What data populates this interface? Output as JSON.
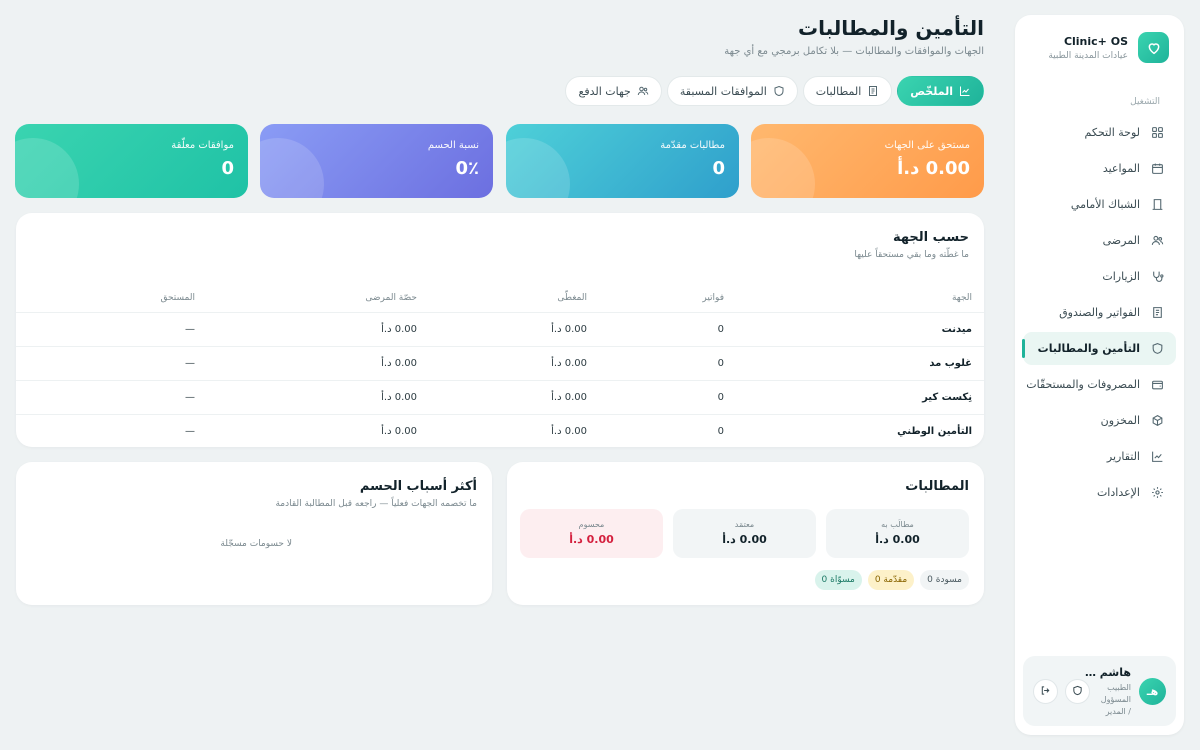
{
  "brand": {
    "name": "Clinic+ OS",
    "subtitle": "عيادات المدينة الطبية"
  },
  "nav": {
    "section": "التشغيل",
    "items": [
      {
        "label": "لوحة التحكم",
        "icon": "grid-icon"
      },
      {
        "label": "المواعيد",
        "icon": "calendar-icon"
      },
      {
        "label": "الشباك الأمامي",
        "icon": "door-icon"
      },
      {
        "label": "المرضى",
        "icon": "users-icon"
      },
      {
        "label": "الزيارات",
        "icon": "stethoscope-icon"
      },
      {
        "label": "الفواتير والصندوق",
        "icon": "receipt-icon"
      },
      {
        "label": "التأمين والمطالبات",
        "icon": "shield-icon",
        "active": true
      },
      {
        "label": "المصروفات والمستحقّات",
        "icon": "wallet-icon"
      },
      {
        "label": "المخزون",
        "icon": "box-icon"
      },
      {
        "label": "التقارير",
        "icon": "chart-icon"
      },
      {
        "label": "الإعدادات",
        "icon": "gear-icon"
      }
    ]
  },
  "user": {
    "initials": "هـ",
    "name": "هاشم …",
    "role": "الطبيب المسؤول / المدير"
  },
  "header": {
    "title": "التأمين والمطالبات",
    "subtitle": "الجهات والموافقات والمطالبات — بلا تكامل برمجي مع أي جهة"
  },
  "tabs": [
    {
      "label": "الملخّص",
      "icon": "chart-icon",
      "active": true
    },
    {
      "label": "المطالبات",
      "icon": "receipt-icon"
    },
    {
      "label": "الموافقات المسبقة",
      "icon": "shield-icon"
    },
    {
      "label": "جهات الدفع",
      "icon": "users-icon"
    }
  ],
  "stats": [
    {
      "label": "مستحق على الجهات",
      "value": "0.00 د.أ"
    },
    {
      "label": "مطالبات مقدّمة",
      "value": "0"
    },
    {
      "label": "نسبة الحسم",
      "value": "0٪"
    },
    {
      "label": "موافقات معلّقة",
      "value": "0"
    }
  ],
  "by_payer": {
    "title": "حسب الجهة",
    "subtitle": "ما غطّته وما بقي مستحقاً عليها",
    "columns": [
      "الجهة",
      "فواتير",
      "المغطّى",
      "حصّة المرضى",
      "المستحق"
    ],
    "rows": [
      [
        "ميدنت",
        "0",
        "0.00 د.أ",
        "0.00 د.أ",
        "—"
      ],
      [
        "غلوب مد",
        "0",
        "0.00 د.أ",
        "0.00 د.أ",
        "—"
      ],
      [
        "نِكست كير",
        "0",
        "0.00 د.أ",
        "0.00 د.أ",
        "—"
      ],
      [
        "التأمين الوطني",
        "0",
        "0.00 د.أ",
        "0.00 د.أ",
        "—"
      ]
    ]
  },
  "claims": {
    "title": "المطالبات",
    "tiles": [
      {
        "label": "مطالَب به",
        "value": "0.00 د.أ"
      },
      {
        "label": "معتمَد",
        "value": "0.00 د.أ"
      },
      {
        "label": "محسوم",
        "value": "0.00 د.أ"
      }
    ],
    "chips": [
      "مسودة 0",
      "مقدّمة 0",
      "مسوّاة 0"
    ],
    "danger_color": "#d4203e"
  },
  "reasons": {
    "title": "أكثر أسباب الحسم",
    "subtitle": "ما تخصمه الجهات فعلياً — راجعه قبل المطالبة القادمة",
    "empty": "لا حسومات مسجّلة"
  },
  "colors": {
    "accent": "#1fb39a",
    "orange": "#ff9b4a",
    "cyan": "#2f9fcc",
    "indigo": "#6c6fe0"
  }
}
